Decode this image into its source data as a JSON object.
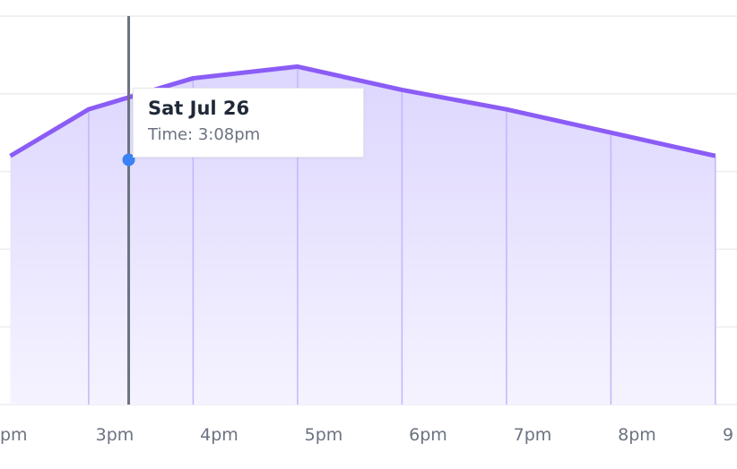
{
  "chart_data": {
    "type": "area",
    "x_ticks": [
      "pm",
      "3pm",
      "4pm",
      "5pm",
      "6pm",
      "7pm",
      "8pm",
      "9"
    ],
    "x": [
      "2:00pm",
      "2:45pm",
      "3:45pm",
      "4:45pm",
      "5:45pm",
      "6:45pm",
      "7:45pm",
      "8:45pm"
    ],
    "values": [
      0.64,
      0.76,
      0.84,
      0.87,
      0.81,
      0.76,
      0.7,
      0.64
    ],
    "ylim": [
      0,
      1
    ],
    "grid": true,
    "colors": {
      "line": "#8b5cf6",
      "fill_top": "#ddd6fe",
      "fill_bottom": "#f5f3ff",
      "cursor": "#6b7280",
      "dot": "#3b82f6",
      "grid": "#ececf1"
    },
    "cursor": {
      "time": "3:08pm",
      "value": 0.63
    }
  },
  "tooltip": {
    "title": "Sat Jul 26",
    "subtitle": "Time: 3:08pm"
  }
}
